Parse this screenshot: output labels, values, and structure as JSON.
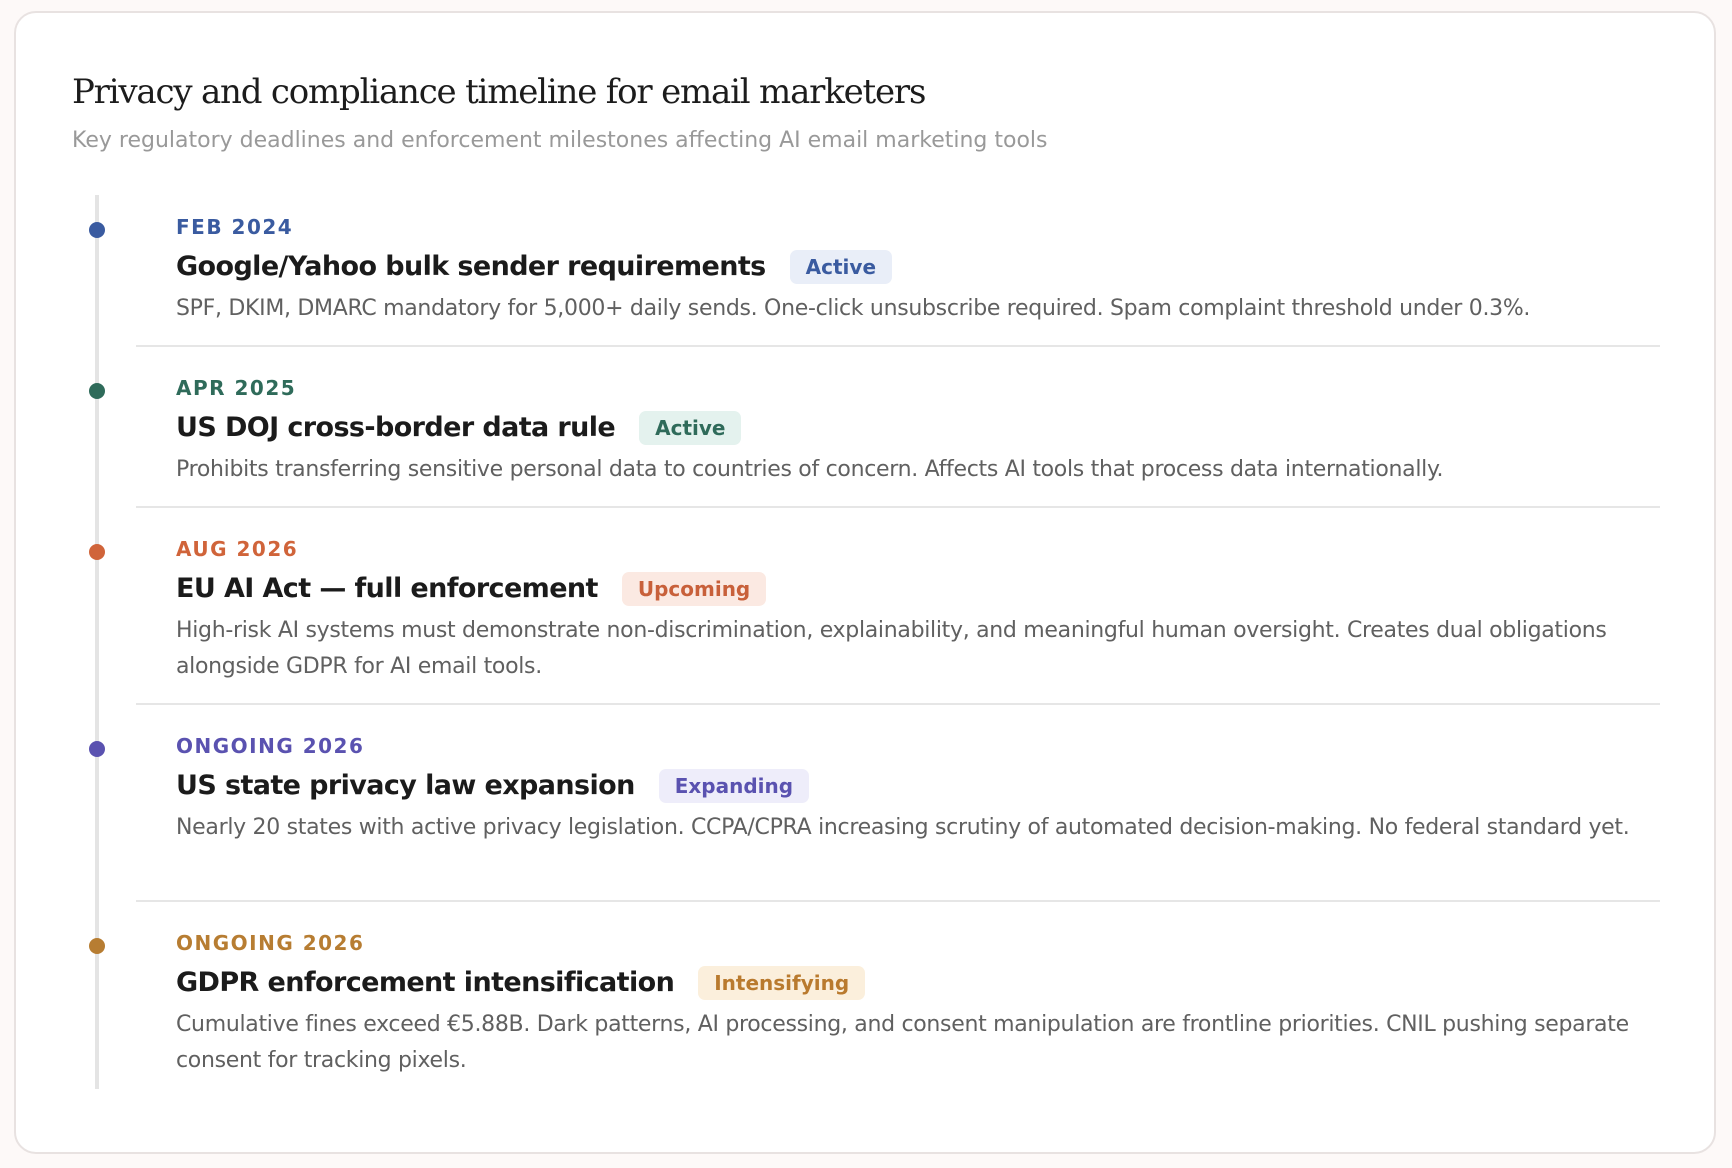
{
  "header": {
    "title": "Privacy and compliance timeline for email marketers",
    "subtitle": "Key regulatory deadlines and enforcement milestones affecting AI email marketing tools"
  },
  "timeline": [
    {
      "date": "FEB 2024",
      "title": "Google/Yahoo bulk sender requirements",
      "badge": "Active",
      "description": "SPF, DKIM, DMARC mandatory for 5,000+ daily sends. One-click unsubscribe required. Spam complaint threshold under 0.3%.",
      "accent_color": "#3a5ba0",
      "badge_bg": "#e9eef8",
      "badge_color": "#3a5ba0"
    },
    {
      "date": "APR 2025",
      "title": "US DOJ cross-border data rule",
      "badge": "Active",
      "description": "Prohibits transferring sensitive personal data to countries of concern. Affects AI tools that process data internationally.",
      "accent_color": "#2f6b5a",
      "badge_bg": "#e4f2ee",
      "badge_color": "#2f6b5a"
    },
    {
      "date": "AUG 2026",
      "title": "EU AI Act — full enforcement",
      "badge": "Upcoming",
      "description": "High-risk AI systems must demonstrate non-discrimination, explainability, and meaningful human oversight. Creates dual obligations alongside GDPR for AI email tools.",
      "accent_color": "#d0643a",
      "badge_bg": "#fbe9e2",
      "badge_color": "#c8603a"
    },
    {
      "date": "ONGOING 2026",
      "title": "US state privacy law expansion",
      "badge": "Expanding",
      "description": "Nearly 20 states with active privacy legislation. CCPA/CPRA increasing scrutiny of automated decision-making. No federal standard yet.",
      "accent_color": "#5a52b0",
      "badge_bg": "#eeedfa",
      "badge_color": "#5a52b0"
    },
    {
      "date": "ONGOING 2026",
      "title": "GDPR enforcement intensification",
      "badge": "Intensifying",
      "description": "Cumulative fines exceed €5.88B. Dark patterns, AI processing, and consent manipulation are frontline priorities. CNIL pushing separate consent for tracking pixels.",
      "accent_color": "#b77d32",
      "badge_bg": "#fbefdc",
      "badge_color": "#b97a2e"
    }
  ]
}
